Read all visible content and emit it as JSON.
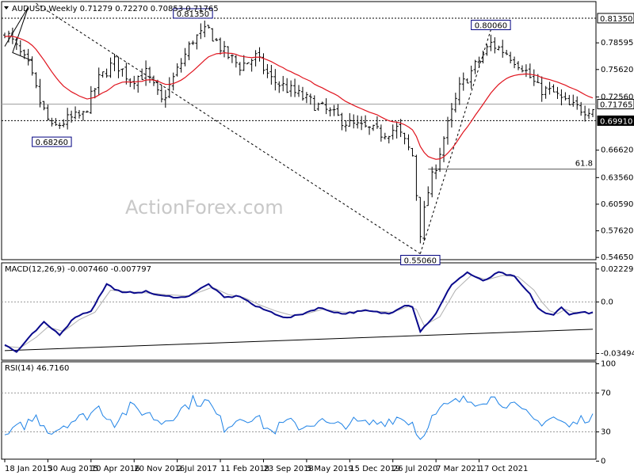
{
  "colors": {
    "price": "#000000",
    "ma": "#e0141e",
    "macd": "#0a0a8c",
    "signal": "#b0b0b0",
    "rsi": "#1e82e6",
    "grid": "#9a9a9a",
    "box": "#000080"
  },
  "chart_data": [
    {
      "type": "ohlc",
      "header": "AUDUSD,Weekly  0.71279 0.72270 0.70853 0.71765",
      "ylim": [
        0.544,
        0.832
      ],
      "yticks": [
        "0.81350",
        "0.78595",
        "0.75620",
        "0.72560",
        "0.69910",
        "0.66620",
        "0.63560",
        "0.60590",
        "0.57620",
        "0.54650"
      ],
      "ytick_values": [
        0.8135,
        0.78595,
        0.7562,
        0.7256,
        0.6991,
        0.6662,
        0.6356,
        0.6059,
        0.5762,
        0.5465
      ],
      "levels": [
        0.8135,
        0.71765,
        0.6991
      ],
      "current": "0.71765",
      "fib": {
        "label": "61.8",
        "value": 0.645
      },
      "annotations": [
        {
          "label": "0.81350",
          "t": 48,
          "v": 0.8135,
          "side": "above"
        },
        {
          "label": "0.68260",
          "t": 12,
          "v": 0.6826,
          "side": "below"
        },
        {
          "label": "0.80060",
          "t": 124,
          "v": 0.8006,
          "side": "above"
        },
        {
          "label": "0.55060",
          "t": 106,
          "v": 0.5506,
          "side": "below"
        }
      ],
      "anchors": [
        [
          0,
          0.8
        ],
        [
          3,
          0.78
        ],
        [
          6,
          0.76
        ],
        [
          9,
          0.72
        ],
        [
          12,
          0.69
        ],
        [
          16,
          0.7
        ],
        [
          20,
          0.705
        ],
        [
          24,
          0.745
        ],
        [
          28,
          0.765
        ],
        [
          32,
          0.745
        ],
        [
          36,
          0.752
        ],
        [
          40,
          0.72
        ],
        [
          44,
          0.755
        ],
        [
          48,
          0.79
        ],
        [
          52,
          0.8
        ],
        [
          56,
          0.775
        ],
        [
          60,
          0.76
        ],
        [
          64,
          0.77
        ],
        [
          68,
          0.745
        ],
        [
          72,
          0.735
        ],
        [
          76,
          0.725
        ],
        [
          80,
          0.715
        ],
        [
          84,
          0.705
        ],
        [
          88,
          0.695
        ],
        [
          92,
          0.69
        ],
        [
          96,
          0.685
        ],
        [
          100,
          0.69
        ],
        [
          104,
          0.66
        ],
        [
          106,
          0.575
        ],
        [
          108,
          0.62
        ],
        [
          112,
          0.68
        ],
        [
          116,
          0.735
        ],
        [
          120,
          0.76
        ],
        [
          124,
          0.785
        ],
        [
          128,
          0.775
        ],
        [
          132,
          0.76
        ],
        [
          136,
          0.735
        ],
        [
          140,
          0.73
        ],
        [
          144,
          0.715
        ],
        [
          148,
          0.712
        ],
        [
          150,
          0.714
        ]
      ]
    },
    {
      "type": "line",
      "header": "MACD(12,26,9) -0.007460 -0.007797",
      "ylim": [
        -0.0395,
        0.0265
      ],
      "yticks": [
        "0.022295",
        "0.0",
        "-0.034948"
      ],
      "ytick_values": [
        0.022295,
        0.0,
        -0.034948
      ],
      "zero": "0.0",
      "trendline": [
        [
          0,
          -0.033
        ],
        [
          150,
          -0.0185
        ]
      ],
      "series": [
        {
          "name": "MACD",
          "anchors": [
            [
              0,
              -0.029
            ],
            [
              3,
              -0.034
            ],
            [
              7,
              -0.022
            ],
            [
              10,
              -0.014
            ],
            [
              14,
              -0.022
            ],
            [
              18,
              -0.01
            ],
            [
              22,
              -0.006
            ],
            [
              26,
              0.012
            ],
            [
              30,
              0.006
            ],
            [
              36,
              0.007
            ],
            [
              40,
              0.004
            ],
            [
              46,
              0.003
            ],
            [
              52,
              0.012
            ],
            [
              56,
              0.003
            ],
            [
              60,
              0.004
            ],
            [
              64,
              -0.003
            ],
            [
              68,
              -0.007
            ],
            [
              72,
              -0.011
            ],
            [
              76,
              -0.008
            ],
            [
              80,
              -0.004
            ],
            [
              86,
              -0.008
            ],
            [
              92,
              -0.006
            ],
            [
              98,
              -0.008
            ],
            [
              102,
              -0.002
            ],
            [
              104,
              -0.003
            ],
            [
              106,
              -0.02
            ],
            [
              110,
              -0.008
            ],
            [
              114,
              0.012
            ],
            [
              118,
              0.02
            ],
            [
              122,
              0.014
            ],
            [
              126,
              0.02
            ],
            [
              130,
              0.017
            ],
            [
              134,
              0.005
            ],
            [
              136,
              -0.004
            ],
            [
              138,
              -0.008
            ],
            [
              140,
              -0.009
            ],
            [
              142,
              -0.003
            ],
            [
              144,
              -0.009
            ],
            [
              146,
              -0.007
            ],
            [
              150,
              -0.0075
            ]
          ]
        },
        {
          "name": "Signal",
          "anchors": [
            [
              0,
              -0.03
            ],
            [
              4,
              -0.031
            ],
            [
              8,
              -0.024
            ],
            [
              11,
              -0.017
            ],
            [
              15,
              -0.02
            ],
            [
              19,
              -0.012
            ],
            [
              23,
              -0.007
            ],
            [
              27,
              0.008
            ],
            [
              31,
              0.007
            ],
            [
              37,
              0.006
            ],
            [
              41,
              0.005
            ],
            [
              47,
              0.004
            ],
            [
              53,
              0.01
            ],
            [
              57,
              0.005
            ],
            [
              61,
              0.003
            ],
            [
              65,
              -0.002
            ],
            [
              69,
              -0.006
            ],
            [
              73,
              -0.009
            ],
            [
              77,
              -0.008
            ],
            [
              81,
              -0.005
            ],
            [
              87,
              -0.007
            ],
            [
              93,
              -0.006
            ],
            [
              99,
              -0.007
            ],
            [
              103,
              -0.003
            ],
            [
              105,
              -0.005
            ],
            [
              107,
              -0.016
            ],
            [
              111,
              -0.01
            ],
            [
              115,
              0.008
            ],
            [
              119,
              0.018
            ],
            [
              123,
              0.015
            ],
            [
              127,
              0.018
            ],
            [
              131,
              0.017
            ],
            [
              135,
              0.008
            ],
            [
              137,
              0.0
            ],
            [
              139,
              -0.006
            ],
            [
              141,
              -0.008
            ],
            [
              143,
              -0.005
            ],
            [
              145,
              -0.007
            ],
            [
              147,
              -0.007
            ],
            [
              150,
              -0.0078
            ]
          ]
        }
      ]
    },
    {
      "type": "line",
      "header": "RSI(14) 46.7160",
      "ylim": [
        2,
        102
      ],
      "yticks": [
        "100",
        "70",
        "30",
        "0"
      ],
      "ytick_values": [
        100,
        70,
        30,
        0
      ],
      "levels": [
        70,
        30
      ],
      "series": [
        {
          "name": "RSI",
          "anchors": [
            [
              0,
              25
            ],
            [
              4,
              35
            ],
            [
              8,
              45
            ],
            [
              12,
              30
            ],
            [
              16,
              40
            ],
            [
              20,
              45
            ],
            [
              24,
              55
            ],
            [
              28,
              40
            ],
            [
              32,
              55
            ],
            [
              36,
              50
            ],
            [
              40,
              40
            ],
            [
              44,
              50
            ],
            [
              48,
              62
            ],
            [
              52,
              60
            ],
            [
              56,
              35
            ],
            [
              60,
              45
            ],
            [
              64,
              45
            ],
            [
              68,
              30
            ],
            [
              72,
              40
            ],
            [
              76,
              35
            ],
            [
              80,
              42
            ],
            [
              84,
              35
            ],
            [
              88,
              40
            ],
            [
              92,
              38
            ],
            [
              96,
              40
            ],
            [
              100,
              45
            ],
            [
              104,
              40
            ],
            [
              106,
              22
            ],
            [
              108,
              40
            ],
            [
              112,
              55
            ],
            [
              116,
              62
            ],
            [
              120,
              62
            ],
            [
              124,
              65
            ],
            [
              128,
              60
            ],
            [
              132,
              50
            ],
            [
              136,
              40
            ],
            [
              140,
              45
            ],
            [
              144,
              35
            ],
            [
              148,
              45
            ],
            [
              150,
              46.7
            ]
          ]
        }
      ]
    }
  ],
  "xaxis": {
    "labels": [
      "18 Jan 2015",
      "30 Aug 2015",
      "10 Apr 2016",
      "20 Nov 2016",
      "2 Jul 2017",
      "11 Feb 2018",
      "23 Sep 2018",
      "5 May 2019",
      "15 Dec 2019",
      "26 Jul 2020",
      "7 Mar 2021",
      "17 Oct 2021"
    ],
    "label_t": [
      0,
      11,
      22,
      33,
      44,
      55,
      66,
      77,
      88,
      99,
      110,
      121
    ]
  },
  "watermark": "ActionForex.com"
}
